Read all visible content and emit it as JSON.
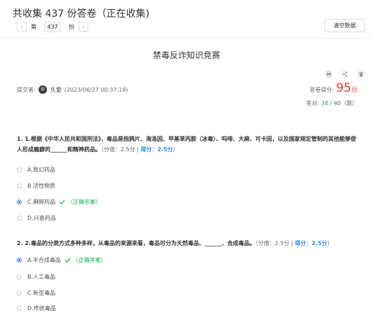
{
  "header": {
    "title": "共收集 437 份答卷（正在收集)",
    "pager": {
      "prefix": "第",
      "page": "437",
      "suffix": "份",
      "prev": "‹",
      "next": "›"
    },
    "clear_label": "清空数据"
  },
  "quiz": {
    "title": "禁毒反诈知识竞赛"
  },
  "toolbar": {
    "icons": [
      "print-icon",
      "share-icon",
      "trash-icon"
    ]
  },
  "submission": {
    "label": "提交者:",
    "name": "久爱",
    "time": "(2023/06/27 00:37:18)",
    "score_label": "答卷得分:",
    "score": "95",
    "score_unit": "分",
    "correct_label": "答对:",
    "correct": "38",
    "total": "/ 40（题）"
  },
  "questions": [
    {
      "text": "1. 1.根据《中华人民共和国刑法》，毒品是指鸦片、海洛因、甲基苯丙胺（冰毒）、吗啡、大麻、可卡因，以及国家规定管制的其他能够使人形成瘾癖的______和精神药品。",
      "meta": "（分值：2.5分 | ",
      "score": "得分：2.5分",
      "meta_end": "）",
      "options": [
        {
          "label": "A.致幻药品",
          "checked": false,
          "correct": false
        },
        {
          "label": "B.活性物质",
          "checked": false,
          "correct": false
        },
        {
          "label": "C.麻醉药品",
          "checked": true,
          "correct": true
        },
        {
          "label": "D.兴奋药品",
          "checked": false,
          "correct": false
        }
      ]
    },
    {
      "text": "2. 2.毒品的分类方式多种多样，从毒品的来源来看，毒品可分为天然毒品、______、合成毒品。",
      "meta": "（分值：2.5分 | ",
      "score": "得分：2.5分",
      "meta_end": "）",
      "options": [
        {
          "label": "A.半合成毒品",
          "checked": true,
          "correct": true
        },
        {
          "label": "B.人工毒品",
          "checked": false,
          "correct": false
        },
        {
          "label": "C.新型毒品",
          "checked": false,
          "correct": false
        },
        {
          "label": "D.传统毒品",
          "checked": false,
          "correct": false
        }
      ]
    }
  ],
  "correct_tag": "（正确答案）",
  "colors": {
    "accent": "#3b84f5",
    "score": "#e5352b",
    "correct": "#1aad5a",
    "score_link": "#2d8cf0"
  }
}
